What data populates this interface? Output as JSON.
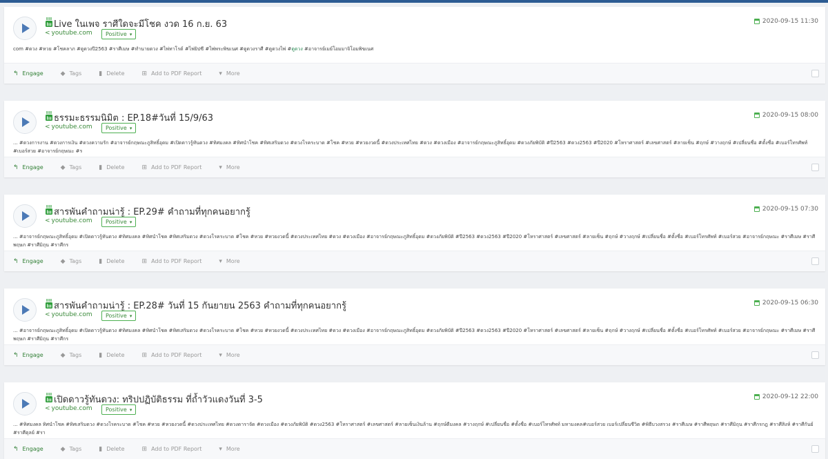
{
  "colors": {
    "topbar": "#2d5c93",
    "accent_green": "#4caf50",
    "play_blue": "#4c7ab6",
    "background": "#eef0f3"
  },
  "icons": {
    "play": "play-icon",
    "youtube": "youtube-icon",
    "calendar": "calendar-icon",
    "share": "share-icon",
    "engage": "reply-icon",
    "tags": "tag-icon",
    "delete": "trash-icon",
    "add_pdf": "plus-square-icon",
    "more": "caret-down-icon"
  },
  "actions": {
    "engage": "Engage",
    "tags": "Tags",
    "delete": "Delete",
    "add_pdf": "Add to PDF Report",
    "more": "More"
  },
  "posts": [
    {
      "title": "Live ในเพจ ราศีใดจะมีโชค งวด 16 ก.ย. 63",
      "source": "youtube.com",
      "sentiment": "Positive",
      "date": "2020-09-15 11:30",
      "snippet_pre": "com #ดวง #หวย #โชคลาภ #ดูดวงปี2563 #ราศีเมษ #ทำนายดวง #ไพ่ทาโรต์ #ไพ่ยิปซี #ไพ่พระพิฆเนศ #ดูดวงราศี #ดูดวงไพ่ #",
      "snippet_hl": "ดูดวง",
      "snippet_post": " #อาจารย์เมย์โอมมาจิโอมพิฆเนศ"
    },
    {
      "title": "ธรรมะธรรมนิมิต : EP.18#วันที่ 15/9/63",
      "source": "youtube.com",
      "sentiment": "Positive",
      "date": "2020-09-15 08:00",
      "snippet_pre": "... #ดวงการงาน #ดวงการเงิน #ดวงความรัก #อาจารย์กฤษณะภูสิทธิ์อุดม #เปิดดาวรู้ทันดวง #ทิศมงคล #ทิศนำโชค #ทิศเสริมดวง #ดวงโรคระบาด #โชค #หวย #หวยงวดนี้ #ดวงประเทศไทย #ดวง #ดวงเมือง #อาจารย์กฤษณะภูสิทธิ์อุดม #ดวงภัยพิบัติ #ปี2563 #ดวง2563 #ปี2020 #โหราศาสตร์ #เลขศาสตร์ #ลายเซ็น #ฤกษ์ #วางฤกษ์ #เปลี่ยนชื่อ #ตั้งชื่อ #เบอร์โทรศัพท์ #เบอร์สวย #อาจารย์กฤษณะ #ร",
      "snippet_hl": "",
      "snippet_post": ""
    },
    {
      "title": "สารพันคำถามน่ารู้ : EP.29# คำถามที่ทุกคนอยากรู้",
      "source": "youtube.com",
      "sentiment": "Positive",
      "date": "2020-09-15 07:30",
      "snippet_pre": "... #อาจารย์กฤษณะภูสิทธิ์อุดม #เปิดดาวรู้ทันดวง #ทิศมงคล #ทิศนำโชค #ทิศเสริมดวง #ดวงโรคระบาด #โชค #หวย #หวยงวดนี้ #ดวงประเทศไทย #ดวง #ดวงเมือง #อาจารย์กฤษณะภูสิทธิ์อุดม #ดวงภัยพิบัติ #ปี2563 #ดวง2563 #ปี2020 #โหราศาสตร์ #เลขศาสตร์ #ลายเซ็น #ฤกษ์ #วางฤกษ์ #เปลี่ยนชื่อ #ตั้งชื่อ #เบอร์โทรศัพท์ #เบอร์สวย #อาจารย์กฤษณะ #ราศีเมษ #ราศีพฤษภ #ราศีมิถุน #ราศีกร",
      "snippet_hl": "",
      "snippet_post": ""
    },
    {
      "title": "สารพันคำถามน่ารู้ : EP.28# วันที่ 15 กันยายน 2563 คำถามที่ทุกคนอยากรู้",
      "source": "youtube.com",
      "sentiment": "Positive",
      "date": "2020-09-15 06:30",
      "snippet_pre": "... #อาจารย์กฤษณะภูสิทธิ์อุดม #เปิดดาวรู้ทันดวง #ทิศมงคล #ทิศนำโชค #ทิศเสริมดวง #ดวงโรคระบาด #โชค #หวย #หวยงวดนี้ #ดวงประเทศไทย #ดวง #ดวงเมือง #อาจารย์กฤษณะภูสิทธิ์อุดม #ดวงภัยพิบัติ #ปี2563 #ดวง2563 #ปี2020 #โหราศาสตร์ #เลขศาสตร์ #ลายเซ็น #ฤกษ์ #วางฤกษ์ #เปลี่ยนชื่อ #ตั้งชื่อ #เบอร์โทรศัพท์ #เบอร์สวย #อาจารย์กฤษณะ #ราศีเมษ #ราศีพฤษภ #ราศีมิถุน #ราศีกร",
      "snippet_hl": "",
      "snippet_post": ""
    },
    {
      "title": "เปิดดาวรู้ทันดวง: ทริปปฏิบัติธรรม ที่ถ้ำวัวแดงวันที่ 3-5",
      "source": "youtube.com",
      "sentiment": "Positive",
      "date": "2020-09-12 22:00",
      "snippet_pre": "... #ทิศมงคล ทิศนำโชค #ทิศเสริมดวง #ดวงโรคระบาด #โชค #หวย #หวยงวดนี้ #ดวงประเทศไทย #ดวงดาราจัด #ดวงเมือง #ดวงภัยพิบัติ #ดวง2563 #โหราศาสตร์ #เลขศาสตร์ #ลายเซ็นเงินล้าน #ฤกษ์ดีมงคล #วางฤกษ์ #เปลี่ยนชื่อ #ตั้งชื่อ #เบอร์โทรศัพท์ มหามงคล#เบอร์สวย เบอร์เปลี่ยนชีวิต #พิธีบวงสรวง #ราศีเมษ #ราศีพฤษภ #ราศีมิถุน #ราศีกรกฎ #ราศีสิงห์ #ราศีกันย์ #ราศีตุลย์ #รา",
      "snippet_hl": "",
      "snippet_post": ""
    }
  ]
}
